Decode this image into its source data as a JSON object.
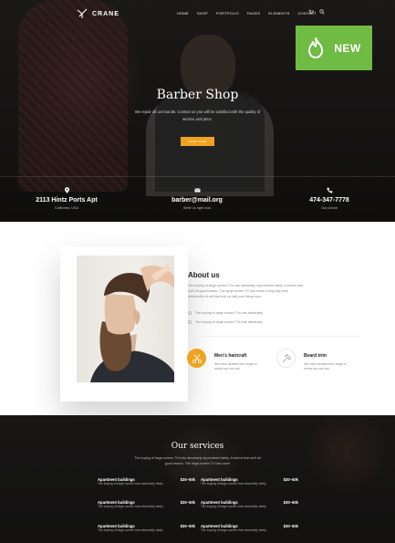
{
  "brand": {
    "name": "CRANE"
  },
  "nav": {
    "items": [
      "HOME",
      "SHOP",
      "PORTFOLIO",
      "PAGES",
      "ELEMENTS",
      "CONTACT"
    ]
  },
  "badge": {
    "label": "NEW",
    "color": "#6fbb43"
  },
  "hero": {
    "title": "Barber Shop",
    "subtitle": "We repair all car brands. Contact us you will be satisfied with the quality of service and price.",
    "button": "SHOP NOW",
    "accent": "#f0a322"
  },
  "contacts": [
    {
      "icon": "location-pin-icon",
      "main": "2113 Hintz Ports Apt",
      "sub": "California, USA"
    },
    {
      "icon": "mail-icon",
      "main": "barber@mail.org",
      "sub": "Write us right now"
    },
    {
      "icon": "phone-icon",
      "main": "474-347-7778",
      "sub": "Our phone"
    }
  ],
  "about": {
    "title": "About us",
    "text": "The buying of large-screen TVs has absolutely skyrocketed lately. It seems that we'll all good reason. The large-screen TV has come a long way from behemoths of old that took up half your living room.",
    "list": [
      "The buying of large-screen TVs has absolutely",
      "The buying of large-screen TVs has absolutely"
    ],
    "services": [
      {
        "icon": "scissors-icon",
        "title": "Men's haircraft",
        "text": "We have divided the range of mixes we can set."
      },
      {
        "icon": "razor-icon",
        "title": "Beard trim",
        "text": "We have divided the range of mixes we can set."
      }
    ]
  },
  "services": {
    "title": "Our services",
    "subtitle": "The buying of large-screen TVs has absolutely skyrocketed lately. It seems that we'll all good reason. The large-screen TV has come",
    "items": [
      {
        "name": "Apartment buildings",
        "price": "$30–50k",
        "desc": "The buying of large-screen has absolutely lately"
      },
      {
        "name": "Apartment buildings",
        "price": "$30–50k",
        "desc": "The buying of large-screen has absolutely lately"
      },
      {
        "name": "Apartment buildings",
        "price": "$30–50k",
        "desc": "The buying of large-screen has absolutely lately"
      },
      {
        "name": "Apartment buildings",
        "price": "$30–50k",
        "desc": "The buying of large-screen has absolutely lately"
      },
      {
        "name": "Apartment buildings",
        "price": "$30–50k",
        "desc": "The buying of large-screen has absolutely lately"
      },
      {
        "name": "Apartment buildings",
        "price": "$30–50k",
        "desc": "The buying of large-screen has absolutely lately"
      }
    ]
  }
}
